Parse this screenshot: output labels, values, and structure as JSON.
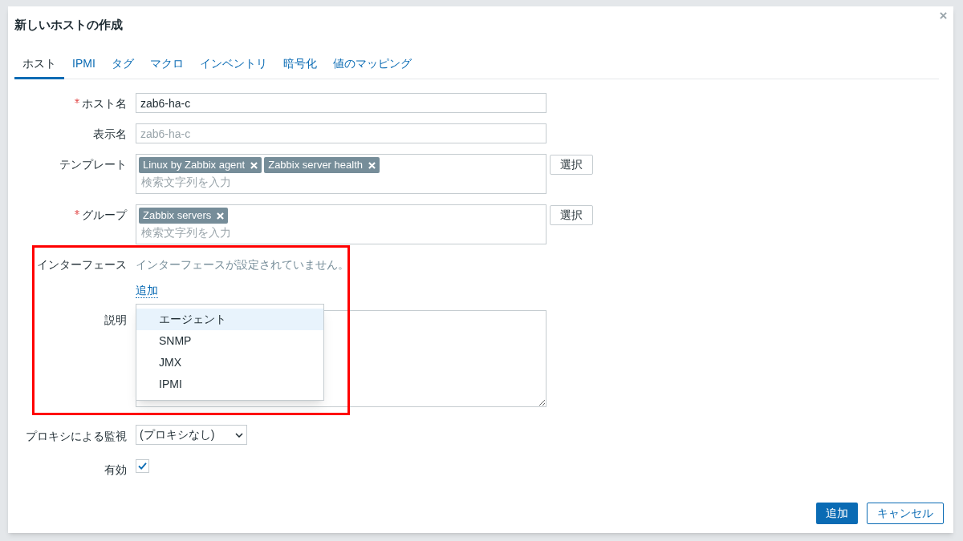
{
  "dialog": {
    "title": "新しいホストの作成"
  },
  "tabs": [
    {
      "label": "ホスト",
      "selected": true
    },
    {
      "label": "IPMI",
      "selected": false
    },
    {
      "label": "タグ",
      "selected": false
    },
    {
      "label": "マクロ",
      "selected": false
    },
    {
      "label": "インベントリ",
      "selected": false
    },
    {
      "label": "暗号化",
      "selected": false
    },
    {
      "label": "値のマッピング",
      "selected": false
    }
  ],
  "host_name": {
    "label": "ホスト名",
    "required": true,
    "value": "zab6-ha-c"
  },
  "display_name": {
    "label": "表示名",
    "required": false,
    "placeholder": "zab6-ha-c"
  },
  "templates": {
    "label": "テンプレート",
    "required": false,
    "tags": [
      "Linux by Zabbix agent",
      "Zabbix server health"
    ],
    "placeholder": "検索文字列を入力",
    "button": "選択"
  },
  "groups": {
    "label": "グループ",
    "required": true,
    "tags": [
      "Zabbix servers"
    ],
    "placeholder": "検索文字列を入力",
    "button": "選択"
  },
  "interfaces": {
    "label": "インターフェース",
    "message": "インターフェースが設定されていません。",
    "add_link": "追加"
  },
  "description": {
    "label": "説明"
  },
  "interface_menu": {
    "items": [
      {
        "label": "エージェント",
        "selected": true
      },
      {
        "label": "SNMP",
        "selected": false
      },
      {
        "label": "JMX",
        "selected": false
      },
      {
        "label": "IPMI",
        "selected": false
      }
    ]
  },
  "proxy": {
    "label": "プロキシによる監視",
    "value": "(プロキシなし)"
  },
  "enabled": {
    "label": "有効",
    "checked": true
  },
  "buttons": [
    {
      "label": "追加",
      "kind": "primary"
    },
    {
      "label": "キャンセル",
      "kind": "secondary"
    }
  ]
}
